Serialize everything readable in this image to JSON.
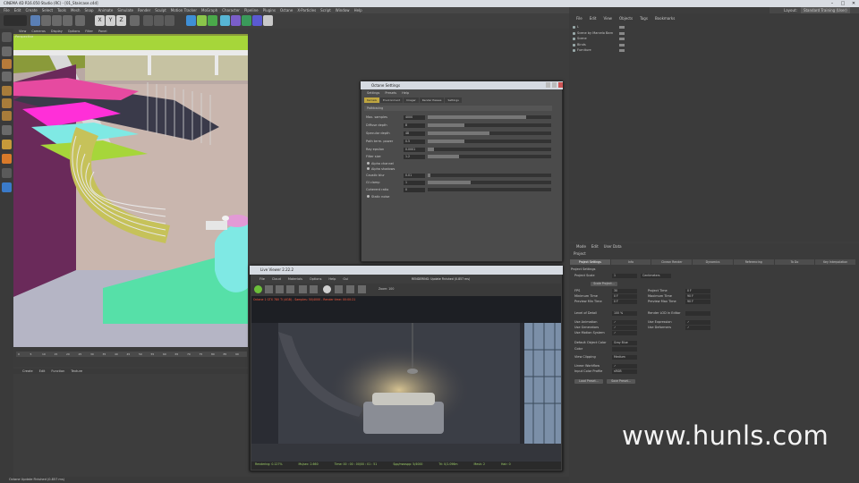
{
  "window": {
    "title": "CINEMA 4D R16.050 Studio (RC) - [01_Staircase.c4d]",
    "controls": [
      "–",
      "□",
      "✕"
    ]
  },
  "menubar": [
    "File",
    "Edit",
    "Create",
    "Select",
    "Tools",
    "Mesh",
    "Snap",
    "Animate",
    "Simulate",
    "Render",
    "Sculpt",
    "Motion Tracker",
    "MoGraph",
    "Character",
    "Pipeline",
    "Plugins",
    "Octane",
    "X-Particles",
    "Script",
    "Window",
    "Help"
  ],
  "layout": {
    "label": "Layout:",
    "value": "Standard Training (User)"
  },
  "viewport": {
    "menu": [
      "View",
      "Cameras",
      "Display",
      "Options",
      "Filter",
      "Panel"
    ],
    "label": "Perspective"
  },
  "timeline": {
    "ticks": [
      "0",
      "5",
      "10",
      "15",
      "20",
      "25",
      "30",
      "35",
      "40",
      "45",
      "50",
      "55",
      "60",
      "65",
      "70",
      "75",
      "80",
      "85",
      "90"
    ]
  },
  "anim_menu": [
    "Create",
    "Edit",
    "Function",
    "Texture"
  ],
  "object_manager": {
    "menu": [
      "File",
      "Edit",
      "View",
      "Objects",
      "Tags",
      "Bookmarks"
    ],
    "objects": [
      "L",
      "Scene by Marcelo Barn",
      "Scene",
      "Binds",
      "Furniture"
    ]
  },
  "attributes": {
    "menu": [
      "Mode",
      "Edit",
      "User Data"
    ],
    "header": "Project",
    "tabs": [
      "Project Settings",
      "Info",
      "Cineon Render",
      "Dynamics",
      "Referencing",
      "To Do",
      "Key Interpolation"
    ],
    "section": "Project Settings",
    "rows_left": [
      {
        "label": "Project Scale",
        "value": "1",
        "unit": "Centimeters"
      },
      {
        "label": "FPS",
        "value": "30"
      },
      {
        "label": "Minimum Time",
        "value": "0 F"
      },
      {
        "label": "Preview Min Time",
        "value": "0 F"
      },
      {
        "label": "Level of Detail",
        "value": "100 %"
      },
      {
        "label": "Use Animation",
        "value": "✓"
      },
      {
        "label": "Use Generators",
        "value": "✓"
      },
      {
        "label": "Use Motion System",
        "value": "✓"
      },
      {
        "label": "Default Object Color",
        "value": "Gray Blue"
      },
      {
        "label": "Color",
        "value": ""
      },
      {
        "label": "View Clipping",
        "value": "Medium"
      },
      {
        "label": "Linear Workflow",
        "value": "✓"
      },
      {
        "label": "Input Color Profile",
        "value": "sRGB"
      }
    ],
    "rows_right": [
      {
        "label": "Project Time",
        "value": "0 F"
      },
      {
        "label": "Maximum Time",
        "value": "90 F"
      },
      {
        "label": "Preview Max Time",
        "value": "90 F"
      },
      {
        "label": "Render LOD in Editor",
        "value": ""
      },
      {
        "label": "Use Expression",
        "value": "✓"
      },
      {
        "label": "Use Deformers",
        "value": "✓"
      }
    ],
    "scale_project_btn": "Scale Project...",
    "load_preset_btn": "Load Preset...",
    "save_preset_btn": "Save Preset..."
  },
  "octane_settings": {
    "title": "Octane Settings",
    "menu": [
      "Settings",
      "Presets",
      "Help"
    ],
    "tabs": [
      "Kernels",
      "Environment",
      "Imager",
      "Render Passes",
      "Settings"
    ],
    "mode": "Pathtracing",
    "rows": [
      {
        "label": "Max. samples",
        "value": "4000",
        "fill": 0.8
      },
      {
        "label": "Diffuse depth",
        "value": "8",
        "fill": 0.3
      },
      {
        "label": "Specular depth",
        "value": "48",
        "fill": 0.5
      },
      {
        "label": "Path term. power",
        "value": "0.5",
        "fill": 0.3
      },
      {
        "label": "Ray epsilon",
        "value": "0.0001",
        "fill": 0.05
      },
      {
        "label": "Filter size",
        "value": "1.2",
        "fill": 0.25
      }
    ],
    "checks": [
      "Alpha channel",
      "Alpha shadows"
    ],
    "rows2": [
      {
        "label": "Caustic blur",
        "value": "0.01",
        "fill": 0.02
      },
      {
        "label": "GI clamp",
        "value": "1",
        "fill": 0.35
      },
      {
        "label": "Coherent ratio",
        "value": "0",
        "fill": 0.0
      }
    ],
    "static_noise": "Static noise"
  },
  "live_viewer": {
    "title": "Live Viewer 2.22.2",
    "menu": [
      "File",
      "Cloud",
      "Materials",
      "Options",
      "Help",
      "Gui"
    ],
    "mid_text": "RENDERING: Update Finished (0.857 ms)",
    "zoom": "Zoom: 100",
    "error": "Octane 1 GTX 780 Ti (4GB) - Samples: 50/4000 - Render time: 00:00:21",
    "status": [
      "Rendering: 0.127%",
      "Ms/sec: 2.660",
      "Time: 00 : 00 : 00/00 : 01 : 51",
      "Spp/maxspp: 5/4000",
      "Tri: 0/1.096m",
      "Mesh: 2",
      "Hair: 0"
    ]
  },
  "watermark": "www.hunls.com",
  "statusbar": "Octane Update Finished (0.857 ms)",
  "colors": {
    "accent": "#bfa640",
    "viewport_green": "#a6d63a",
    "magenta": "#ff2fd8",
    "cyan": "#7fe9e4"
  }
}
